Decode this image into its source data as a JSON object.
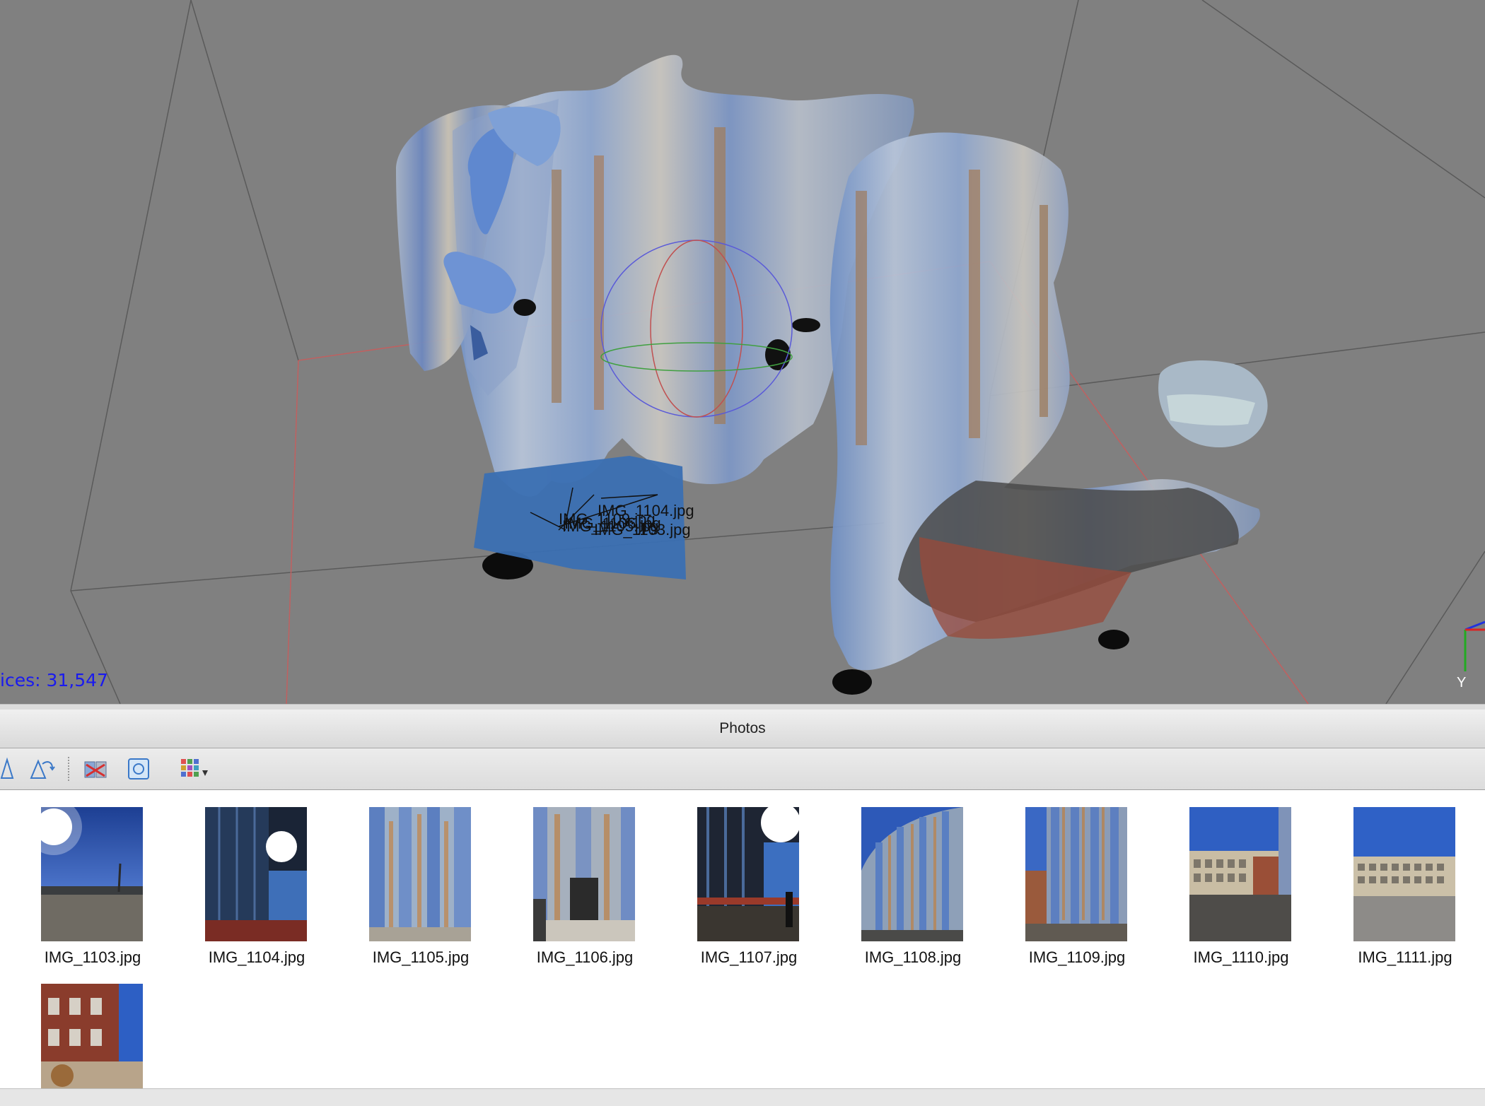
{
  "viewport": {
    "vertex_readout": "ices: 31,547",
    "camera_labels": [
      "IMG_1104.jpg",
      "IMG_1105.jpg",
      "IMG_1106.jpg",
      "IMG_1103.jpg",
      "IMG_1109.jpg"
    ],
    "axis_y_label": "Y",
    "background_color": "#808080"
  },
  "photos_panel": {
    "title": "Photos",
    "toolbar": [
      {
        "icon": "rotate-right-icon"
      },
      {
        "icon": "rotate-left-icon"
      },
      {
        "icon": "remove-cameras-icon"
      },
      {
        "icon": "reset-view-icon"
      },
      {
        "icon": "view-mode-grid-icon",
        "has_dropdown": true
      }
    ],
    "photos": [
      {
        "label": "IMG_1103.jpg",
        "scene": "sun-sky"
      },
      {
        "label": "IMG_1104.jpg",
        "scene": "glass-sun"
      },
      {
        "label": "IMG_1105.jpg",
        "scene": "glass-facade"
      },
      {
        "label": "IMG_1106.jpg",
        "scene": "entrance"
      },
      {
        "label": "IMG_1107.jpg",
        "scene": "glass-sun-dark"
      },
      {
        "label": "IMG_1108.jpg",
        "scene": "curved-glass"
      },
      {
        "label": "IMG_1109.jpg",
        "scene": "glass-brick"
      },
      {
        "label": "IMG_1110.jpg",
        "scene": "campus-building"
      },
      {
        "label": "IMG_1111.jpg",
        "scene": "campus-building-wide"
      },
      {
        "label": "",
        "scene": "brick-building"
      }
    ]
  }
}
